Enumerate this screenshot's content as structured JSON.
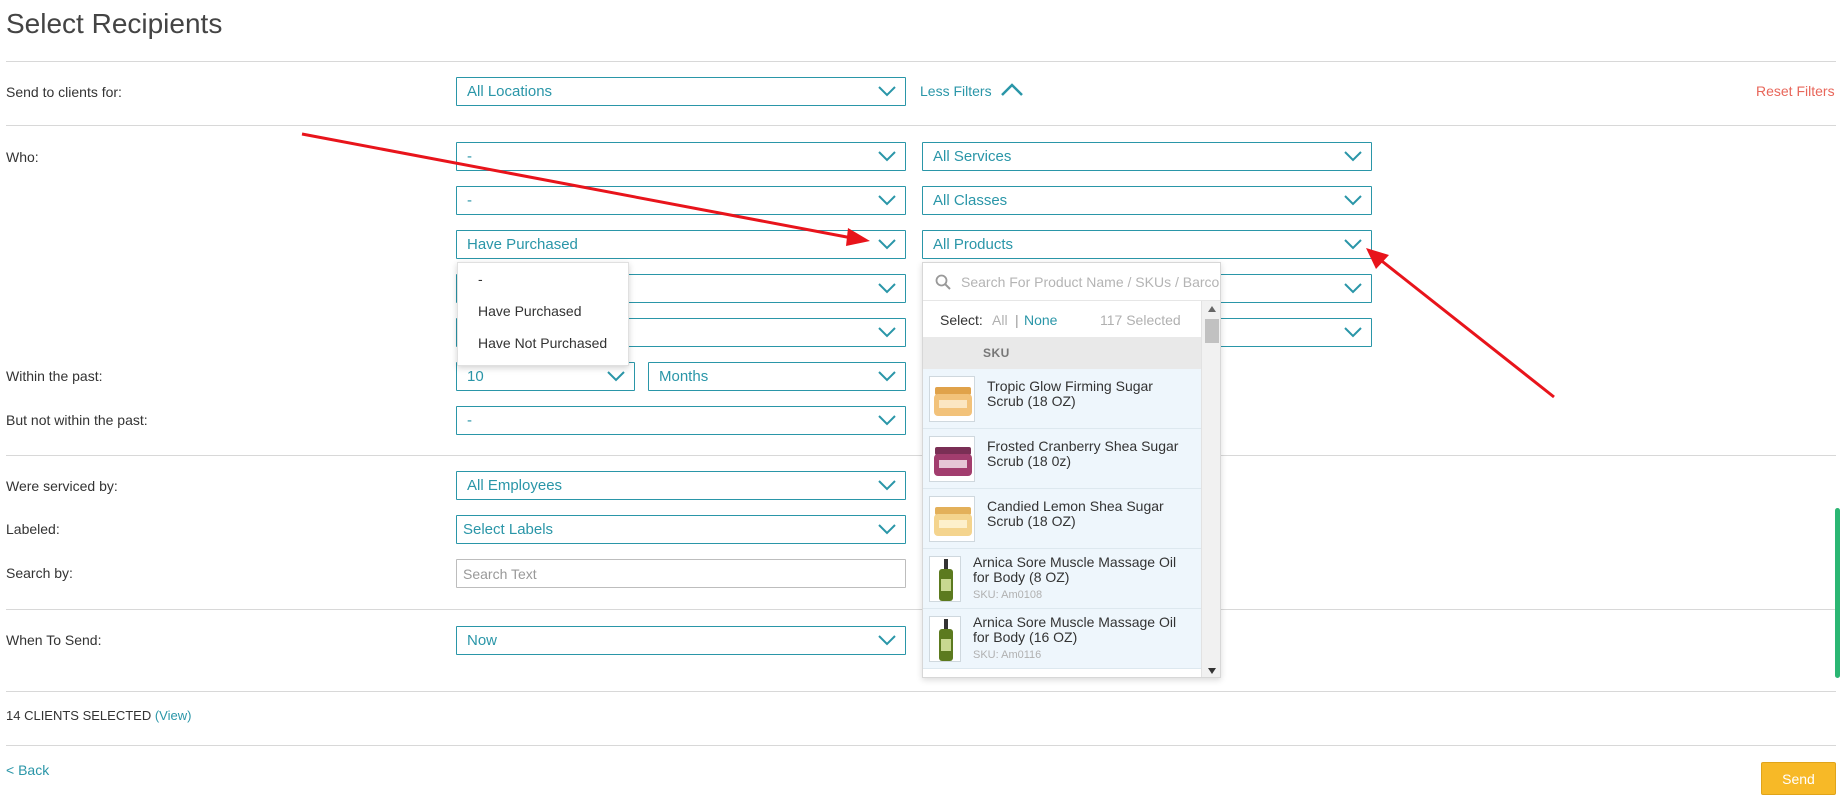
{
  "page": {
    "title": "Select Recipients"
  },
  "filters": {
    "send_to_label": "Send to clients for:",
    "locations_value": "All Locations",
    "less_filters": "Less Filters",
    "reset_filters": "Reset Filters",
    "who_label": "Who:",
    "who_rows": [
      {
        "left": "-",
        "right": "All Services"
      },
      {
        "left": "-",
        "right": "All Classes"
      },
      {
        "left": "Have Purchased",
        "right": "All Products"
      },
      {
        "left": "",
        "right": ""
      },
      {
        "left": "",
        "right": ""
      }
    ],
    "within_label": "Within the past:",
    "within_value": "10",
    "within_unit": "Months",
    "not_within_label": "But not within the past:",
    "not_within_value": "-",
    "serviced_label": "Were serviced by:",
    "serviced_value": "All Employees",
    "labeled_label": "Labeled:",
    "labeled_value": "Select Labels",
    "search_label": "Search by:",
    "search_placeholder": "Search Text",
    "when_label": "When To Send:",
    "when_value": "Now"
  },
  "purchase_menu": {
    "options": [
      "-",
      "Have Purchased",
      "Have Not Purchased"
    ]
  },
  "product_panel": {
    "search_placeholder": "Search For Product Name / SKUs / Barcode",
    "select_label": "Select:",
    "all": "All",
    "separator": "|",
    "none": "None",
    "selected_count": "117 Selected",
    "sku_header": "SKU",
    "products": [
      {
        "name": "Tropic Glow Firming Sugar Scrub (18 OZ)",
        "sku": ""
      },
      {
        "name": "Frosted Cranberry Shea Sugar Scrub (18 0z)",
        "sku": ""
      },
      {
        "name": "Candied Lemon Shea Sugar Scrub (18 OZ)",
        "sku": ""
      },
      {
        "name": "Arnica Sore Muscle Massage Oil for Body (8 OZ)",
        "sku": "SKU: Am0108"
      },
      {
        "name": "Arnica Sore Muscle Massage Oil for Body (16 OZ)",
        "sku": "SKU: Am0116"
      }
    ]
  },
  "footer": {
    "clients_selected": "14 CLIENTS SELECTED",
    "view_link": "(View)",
    "back": "< Back",
    "send": "Send"
  },
  "colors": {
    "accent": "#2a96a8",
    "reset": "#e8665a",
    "send": "#f7b927",
    "arrow": "#e8141b",
    "row_bg": "#eef6fc"
  }
}
